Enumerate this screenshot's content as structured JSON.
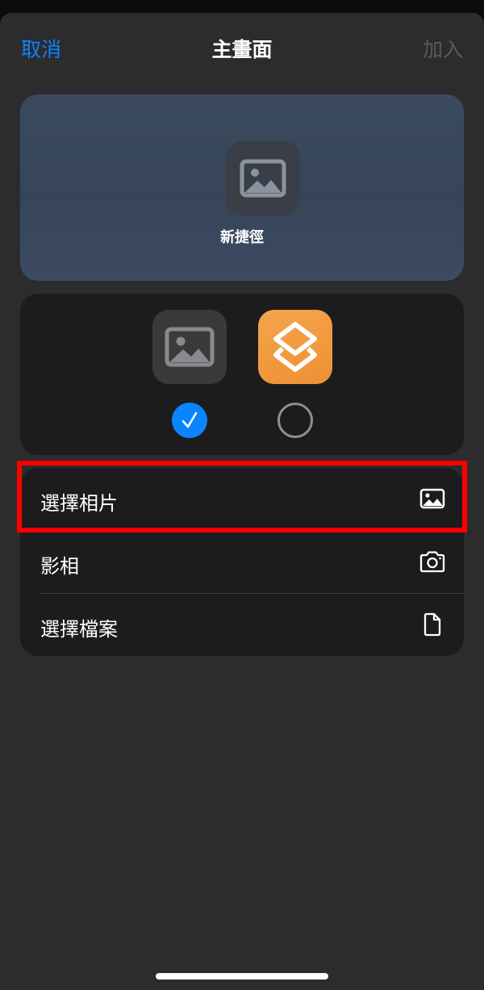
{
  "nav": {
    "cancel_label": "取消",
    "title": "主畫面",
    "add_label": "加入"
  },
  "preview": {
    "shortcut_name": "新捷徑"
  },
  "icon_picker": {
    "options": [
      {
        "icon": "photo-icon",
        "selected": true
      },
      {
        "icon": "shortcuts-icon",
        "selected": false
      }
    ]
  },
  "source_menu": {
    "items": [
      {
        "label": "選擇相片",
        "icon": "photo-icon"
      },
      {
        "label": "影相",
        "icon": "camera-icon"
      },
      {
        "label": "選擇檔案",
        "icon": "document-icon"
      }
    ]
  },
  "colors": {
    "accent": "#0a84ff",
    "highlight": "#ff0000",
    "shortcuts_orange": "#f19a3e"
  }
}
